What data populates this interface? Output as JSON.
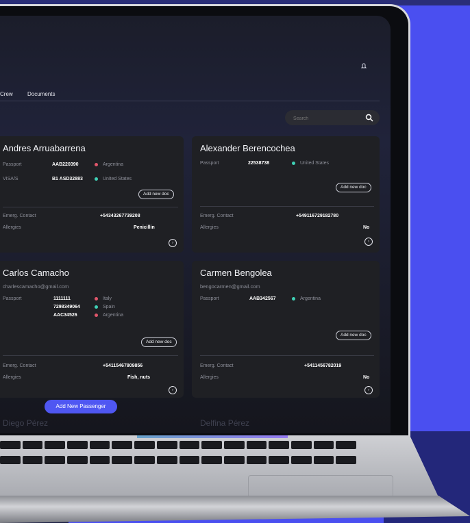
{
  "nav": {
    "tabs": [
      "Crew",
      "Documents"
    ]
  },
  "search": {
    "placeholder": "Search"
  },
  "cta": {
    "label": "Add New Passenger"
  },
  "colors": {
    "accent": "#4f57f2",
    "argentina": "#e0566b",
    "usa": "#3fd0b6",
    "italy": "#e0566b",
    "spain": "#3fd0b6"
  },
  "passengers": [
    {
      "name": "Andres Arruabarrena",
      "docs": [
        {
          "type": "Passport",
          "number": "AAB220390",
          "country": "Argentina"
        },
        {
          "type": "VISA/S",
          "number": "B1 ASD32883",
          "country": "United States"
        }
      ],
      "add_doc": "Add new doc",
      "emerg_label": "Emerg. Contact",
      "emerg": "+54343267739208",
      "allergies_label": "Allergies",
      "allergies": "Penicillin"
    },
    {
      "name": "Alexander Berencochea",
      "docs": [
        {
          "type": "Passport",
          "number": "22538738",
          "country": "United States"
        }
      ],
      "add_doc": "Add new doc",
      "emerg_label": "Emerg. Contact",
      "emerg": "+549116729182780",
      "allergies_label": "Allergies",
      "allergies": "No"
    },
    {
      "name": "Carlos Camacho",
      "email": "charlescamacho@gmail.com",
      "docs": [
        {
          "type": "Passport",
          "number": "1111111",
          "country": "Italy"
        },
        {
          "type": "",
          "number": "7298349064",
          "country": "Spain"
        },
        {
          "type": "",
          "number": "AAC34526",
          "country": "Argentina"
        }
      ],
      "add_doc": "Add new doc",
      "emerg_label": "Emerg. Contact",
      "emerg": "+54115467809856",
      "allergies_label": "Allergies",
      "allergies": "Fish, nuts"
    },
    {
      "name": "Carmen Bengolea",
      "email": "bengocarmen@gmail.com",
      "docs": [
        {
          "type": "Passport",
          "number": "AAB342567",
          "country": "Argentina"
        }
      ],
      "add_doc": "Add new doc",
      "emerg_label": "Emerg. Contact",
      "emerg": "+5411456782019",
      "allergies_label": "Allergies",
      "allergies": "No"
    }
  ],
  "ghost_names": [
    "Diego Pérez",
    "Delfina Pérez"
  ]
}
